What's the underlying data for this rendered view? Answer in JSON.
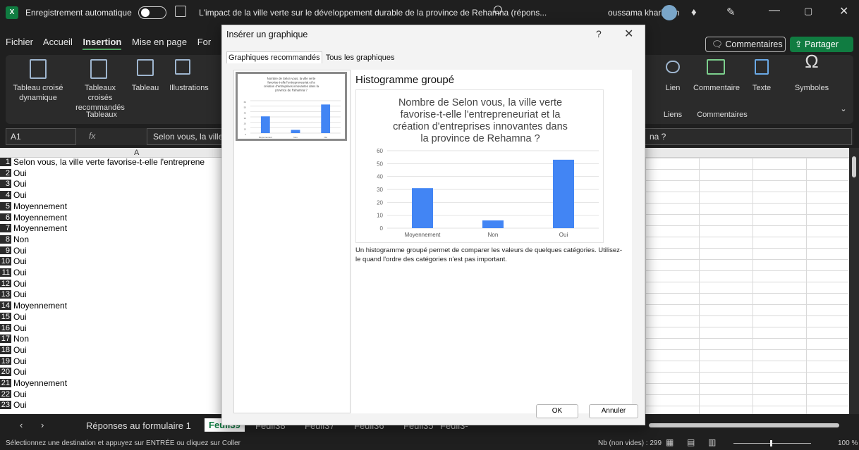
{
  "titlebar": {
    "autosave_label": "Enregistrement automatique",
    "doc_title": "L'impact de la ville verte sur le développement durable de la province de Rehamna (répons...",
    "user": "oussama kharbach",
    "logo": "X"
  },
  "ribbon_tabs": [
    "Fichier",
    "Accueil",
    "Insertion",
    "Mise en page",
    "For"
  ],
  "active_tab": "Insertion",
  "header_buttons": {
    "comments": "Commentaires",
    "share": "Partager"
  },
  "ribbon": {
    "items": [
      "Tableau croisé dynamique",
      "Tableaux croisés recommandés",
      "Tableau",
      "Illustrations"
    ],
    "group_tableaux": "Tableaux",
    "right_items": [
      "Lien",
      "Commentaire",
      "Texte",
      "Symboles"
    ],
    "group_liens": "Liens",
    "group_commentaires": "Commentaires"
  },
  "formula_bar": {
    "name_box": "A1",
    "fx": "fx",
    "formula": "Selon vous, la ville",
    "formula_tail": "na ?"
  },
  "sheet": {
    "column_a": "A",
    "header_text": "Selon vous, la ville verte favorise-t-elle l'entreprene",
    "rows": [
      {
        "n": "1",
        "v": "Selon vous, la ville verte favorise-t-elle l'entreprene"
      },
      {
        "n": "2",
        "v": "Oui"
      },
      {
        "n": "3",
        "v": "Oui"
      },
      {
        "n": "4",
        "v": "Oui"
      },
      {
        "n": "5",
        "v": "Moyennement"
      },
      {
        "n": "6",
        "v": "Moyennement"
      },
      {
        "n": "7",
        "v": "Moyennement"
      },
      {
        "n": "8",
        "v": "Non"
      },
      {
        "n": "9",
        "v": "Oui"
      },
      {
        "n": "10",
        "v": "Oui"
      },
      {
        "n": "11",
        "v": "Oui"
      },
      {
        "n": "12",
        "v": "Oui"
      },
      {
        "n": "13",
        "v": "Oui"
      },
      {
        "n": "14",
        "v": "Moyennement"
      },
      {
        "n": "15",
        "v": "Oui"
      },
      {
        "n": "16",
        "v": "Oui"
      },
      {
        "n": "17",
        "v": "Non"
      },
      {
        "n": "18",
        "v": "Oui"
      },
      {
        "n": "19",
        "v": "Oui"
      },
      {
        "n": "20",
        "v": "Oui"
      },
      {
        "n": "21",
        "v": "Moyennement"
      },
      {
        "n": "22",
        "v": "Oui"
      },
      {
        "n": "23",
        "v": "Oui"
      }
    ]
  },
  "sheet_tabs": [
    "Réponses au formulaire 1",
    "Feuil39",
    "Feuil38",
    "Feuil37",
    "Feuil36",
    "Feuil35",
    "Feuil3-"
  ],
  "status": {
    "left": "Sélectionnez une destination et appuyez sur ENTRÉE ou cliquez sur Coller",
    "count": "Nb (non vides) : 299",
    "zoom": "100 %"
  },
  "dialog": {
    "title": "Insérer un graphique",
    "help": "?",
    "close": "✕",
    "tab_recommended": "Graphiques recommandés",
    "tab_all": "Tous les graphiques",
    "chart_type_title": "Histogramme groupé",
    "description": "Un histogramme groupé permet de comparer les valeurs de quelques catégories. Utilisez-le quand l'ordre des catégories n'est pas important.",
    "ok": "OK",
    "cancel": "Annuler"
  },
  "chart_data": {
    "type": "bar",
    "title": "Nombre de Selon vous, la ville verte favorise-t-elle l'entrepreneuriat et la création d'entreprises innovantes dans la province de Rehamna ?",
    "categories": [
      "Moyennement",
      "Non",
      "Oui"
    ],
    "values": [
      31,
      6,
      53
    ],
    "ylim": [
      0,
      60
    ],
    "yticks": [
      0,
      10,
      20,
      30,
      40,
      50,
      60
    ],
    "xlabel": "",
    "ylabel": "",
    "grid": true,
    "bar_color": "#4285f4"
  },
  "colors": {
    "excel_green": "#107c41",
    "accent_bar": "#4285f4"
  }
}
